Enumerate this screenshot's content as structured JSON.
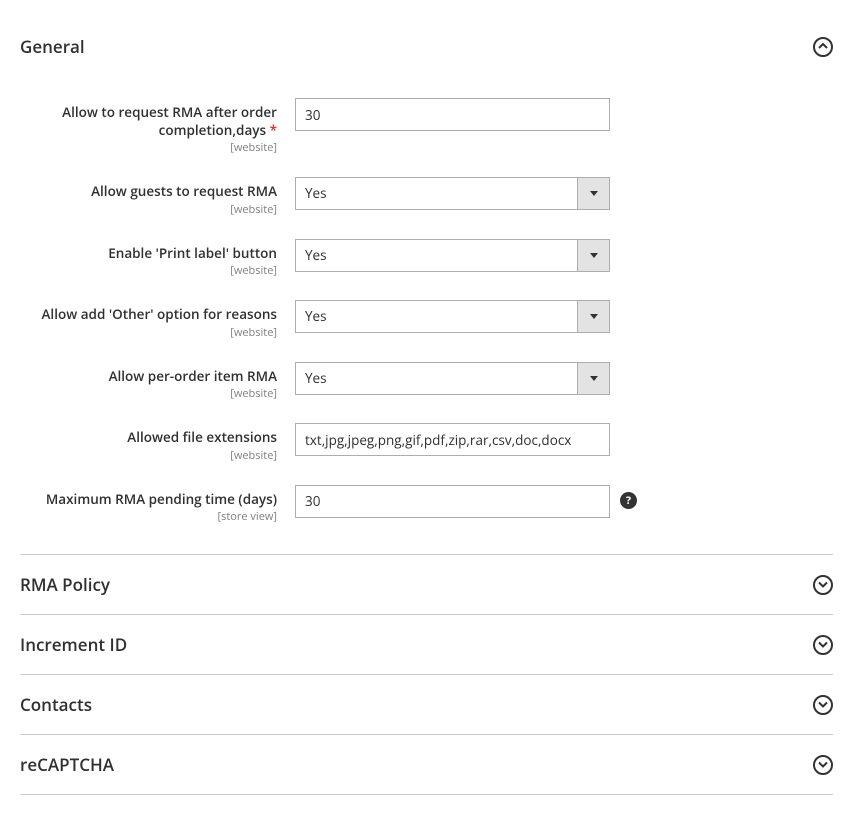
{
  "sections": {
    "general": {
      "title": "General",
      "expanded": true,
      "fields": {
        "rma_days": {
          "label": "Allow to request RMA after order completion,days",
          "required": true,
          "scope": "[website]",
          "value": "30"
        },
        "guest_rma": {
          "label": "Allow guests to request RMA",
          "scope": "[website]",
          "value": "Yes"
        },
        "print_label": {
          "label": "Enable 'Print label' button",
          "scope": "[website]",
          "value": "Yes"
        },
        "other_reason": {
          "label": "Allow add 'Other' option for reasons",
          "scope": "[website]",
          "value": "Yes"
        },
        "per_order": {
          "label": "Allow per-order item RMA",
          "scope": "[website]",
          "value": "Yes"
        },
        "file_ext": {
          "label": "Allowed file extensions",
          "scope": "[website]",
          "value": "txt,jpg,jpeg,png,gif,pdf,zip,rar,csv,doc,docx"
        },
        "pending_time": {
          "label": "Maximum RMA pending time (days)",
          "scope": "[store view]",
          "value": "30"
        }
      }
    },
    "rma_policy": {
      "title": "RMA Policy"
    },
    "increment_id": {
      "title": "Increment ID"
    },
    "contacts": {
      "title": "Contacts"
    },
    "recaptcha": {
      "title": "reCAPTCHA"
    }
  },
  "required_marker": "*",
  "help_marker": "?"
}
